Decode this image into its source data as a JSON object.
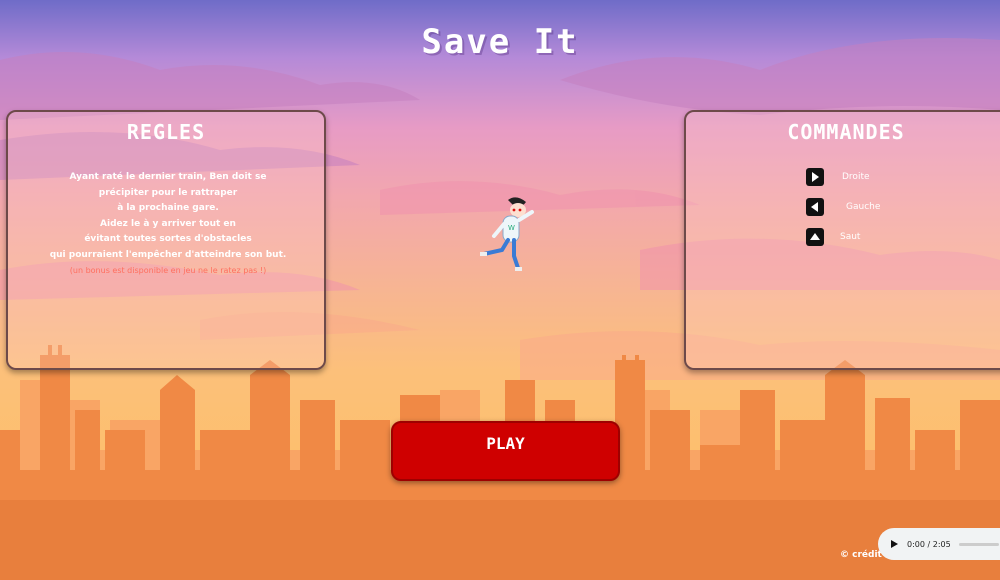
{
  "game": {
    "title": "Save It"
  },
  "rules_panel": {
    "heading": "REGLES",
    "lines": [
      "Ayant raté le dernier train, Ben doit se",
      "précipiter pour le rattraper",
      "à la prochaine gare.",
      "Aidez le à y arriver tout en",
      "évitant toutes sortes d'obstacles",
      "qui pourraient l'empêcher d'atteindre son but."
    ],
    "bonus": "(un bonus est disponible en jeu ne le ratez pas !)"
  },
  "commands_panel": {
    "heading": "COMMANDES",
    "items": [
      {
        "icon": "arrow-right-key-icon",
        "label": "Droite"
      },
      {
        "icon": "arrow-left-key-icon",
        "label": "Gauche"
      },
      {
        "icon": "arrow-up-key-icon",
        "label": "Saut"
      }
    ]
  },
  "play_button": {
    "label": "PLAY"
  },
  "footer": {
    "credit": "© crédit"
  },
  "audio_player": {
    "time": "0:00 / 2:05"
  },
  "colors": {
    "play_button": "#cf0000",
    "sky_top": "#6f6cc8",
    "sky_bottom": "#fdbf6e",
    "city": "#f58a4b",
    "bonus_text": "#ff6f5f"
  }
}
